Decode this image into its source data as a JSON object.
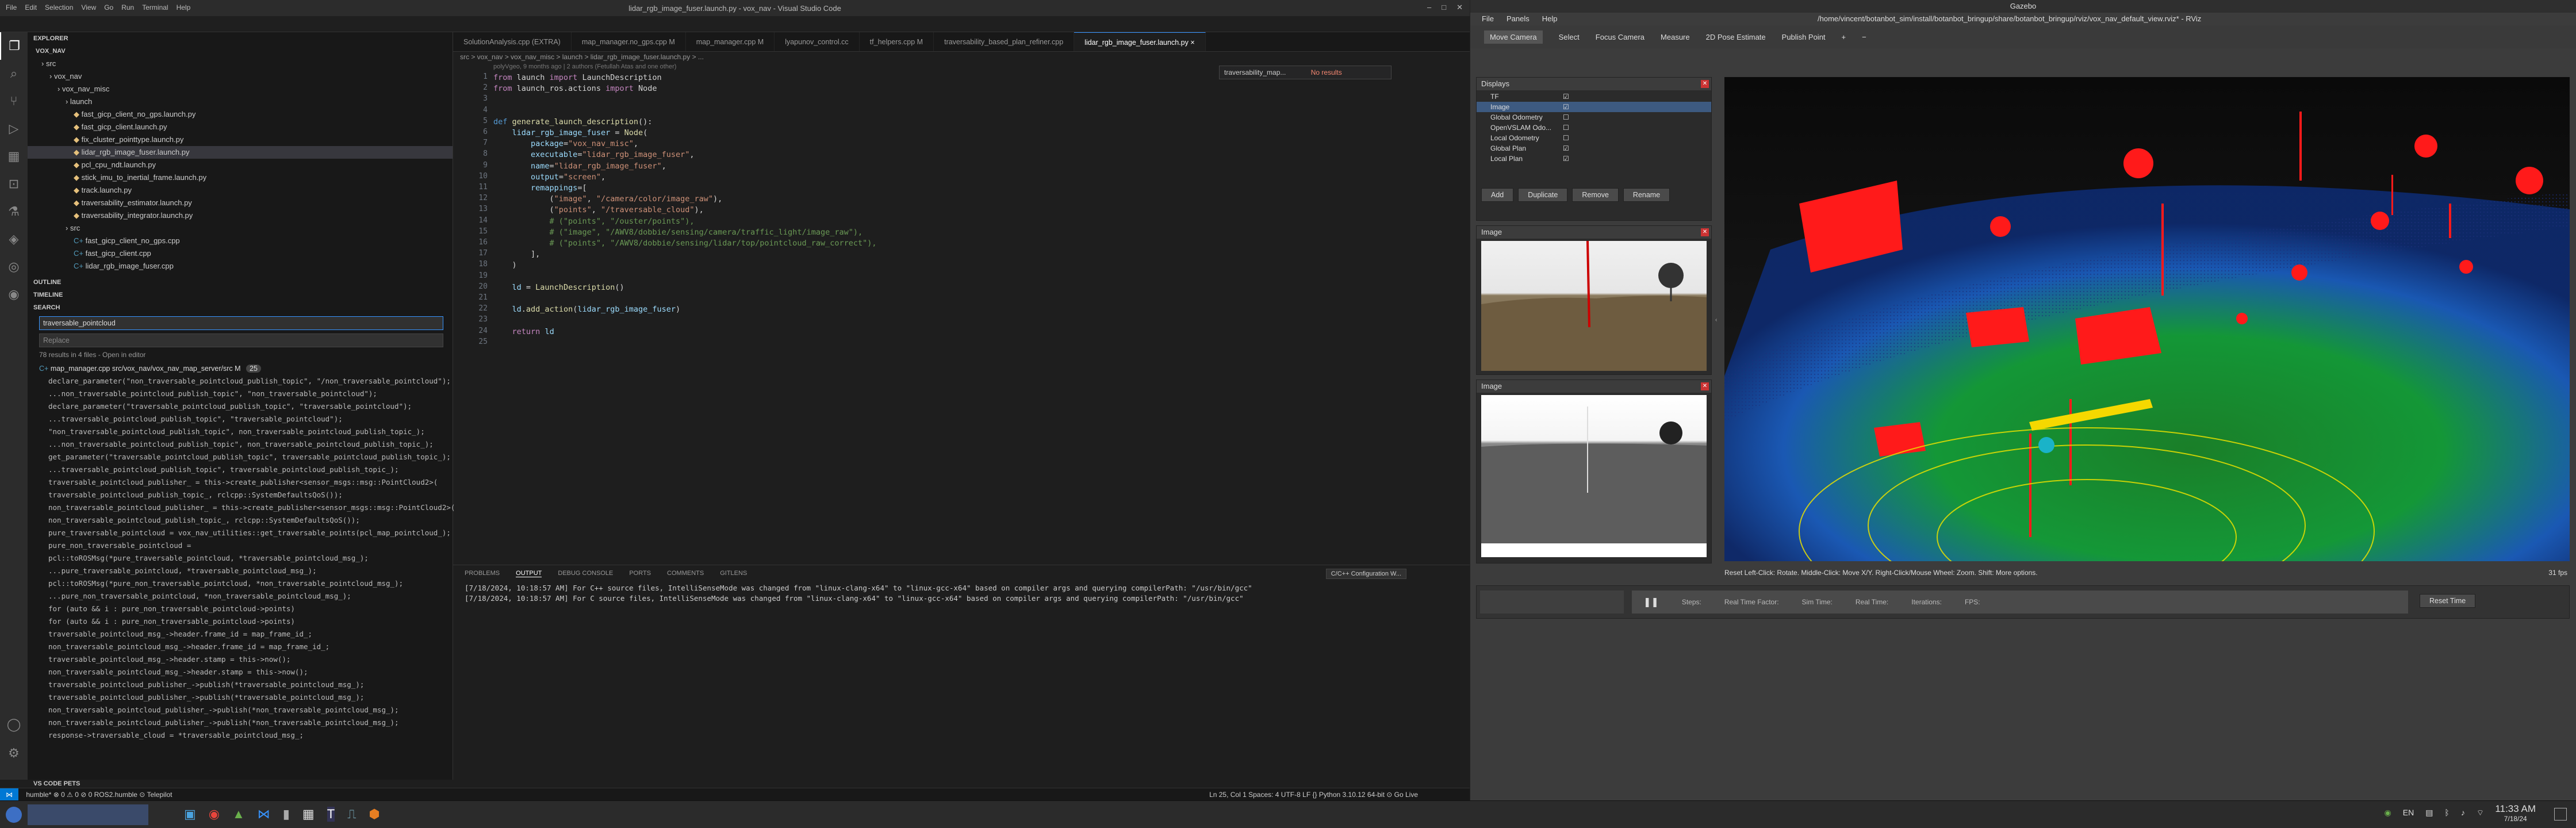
{
  "vscode": {
    "title": "lidar_rgb_image_fuser.launch.py - vox_nav - Visual Studio Code",
    "menu": [
      "File",
      "Edit",
      "Selection",
      "View",
      "Go",
      "Run",
      "Terminal",
      "Help"
    ],
    "explorer_title": "EXPLORER",
    "root": "VOX_NAV",
    "tree": [
      {
        "label": "src",
        "indent": 1
      },
      {
        "label": "vox_nav",
        "indent": 2
      },
      {
        "label": "vox_nav_misc",
        "indent": 3
      },
      {
        "label": "launch",
        "indent": 4
      },
      {
        "label": "fast_gicp_client_no_gps.launch.py",
        "indent": 5
      },
      {
        "label": "fast_gicp_client.launch.py",
        "indent": 5
      },
      {
        "label": "fix_cluster_pointtype.launch.py",
        "indent": 5
      },
      {
        "label": "lidar_rgb_image_fuser.launch.py",
        "indent": 5,
        "selected": true
      },
      {
        "label": "pcl_cpu_ndt.launch.py",
        "indent": 5
      },
      {
        "label": "stick_imu_to_inertial_frame.launch.py",
        "indent": 5
      },
      {
        "label": "track.launch.py",
        "indent": 5
      },
      {
        "label": "traversability_estimator.launch.py",
        "indent": 5
      },
      {
        "label": "traversability_integrator.launch.py",
        "indent": 5
      },
      {
        "label": "src",
        "indent": 4
      },
      {
        "label": "fast_gicp_client_no_gps.cpp",
        "indent": 5
      },
      {
        "label": "fast_gicp_client.cpp",
        "indent": 5
      },
      {
        "label": "lidar_rgb_image_fuser.cpp",
        "indent": 5
      }
    ],
    "outline": "OUTLINE",
    "timeline": "TIMELINE",
    "search": "SEARCH",
    "search_query": "traversable_pointcloud",
    "replace_placeholder": "Replace",
    "results_summary": "78 results in 4 files - Open in editor",
    "results_file": "map_manager.cpp  src/vox_nav/vox_nav_map_server/src  M",
    "results_count": "25",
    "results": [
      "declare_parameter(\"non_traversable_pointcloud_publish_topic\", \"/non_traversable_pointcloud\");",
      "...non_traversable_pointcloud_publish_topic\", \"non_traversable_pointcloud\");",
      "declare_parameter(\"traversable_pointcloud_publish_topic\", \"traversable_pointcloud\");",
      "...traversable_pointcloud_publish_topic\", \"traversable_pointcloud\");",
      "\"non_traversable_pointcloud_publish_topic\", non_traversable_pointcloud_publish_topic_);",
      "...non_traversable_pointcloud_publish_topic\", non_traversable_pointcloud_publish_topic_);",
      "get_parameter(\"traversable_pointcloud_publish_topic\", traversable_pointcloud_publish_topic_);",
      "...traversable_pointcloud_publish_topic\", traversable_pointcloud_publish_topic_);",
      "traversable_pointcloud_publisher_ = this->create_publisher<sensor_msgs::msg::PointCloud2>(",
      "traversable_pointcloud_publish_topic_, rclcpp::SystemDefaultsQoS());",
      "non_traversable_pointcloud_publisher_ = this->create_publisher<sensor_msgs::msg::PointCloud2>(",
      "non_traversable_pointcloud_publish_topic_, rclcpp::SystemDefaultsQoS());",
      "pure_traversable_pointcloud = vox_nav_utilities::get_traversable_points(pcl_map_pointcloud_);",
      "pure_non_traversable_pointcloud =",
      "pcl::toROSMsg(*pure_traversable_pointcloud, *traversable_pointcloud_msg_);",
      "...pure_traversable_pointcloud, *traversable_pointcloud_msg_);",
      "pcl::toROSMsg(*pure_non_traversable_pointcloud, *non_traversable_pointcloud_msg_);",
      "...pure_non_traversable_pointcloud, *non_traversable_pointcloud_msg_);",
      "for (auto && i : pure_non_traversable_pointcloud->points)",
      "for (auto && i : pure_non_traversable_pointcloud->points)",
      "traversable_pointcloud_msg_->header.frame_id = map_frame_id_;",
      "non_traversable_pointcloud_msg_->header.frame_id = map_frame_id_;",
      "traversable_pointcloud_msg_->header.stamp = this->now();",
      "non_traversable_pointcloud_msg_->header.stamp = this->now();",
      "traversable_pointcloud_publisher_->publish(*traversable_pointcloud_msg_);",
      "traversable_pointcloud_publisher_->publish(*traversable_pointcloud_msg_);",
      "non_traversable_pointcloud_publisher_->publish(*non_traversable_pointcloud_msg_);",
      "non_traversable_pointcloud_publisher_->publish(*non_traversable_pointcloud_msg_);",
      "response->traversable_cloud = *traversable_pointcloud_msg_;"
    ],
    "vs_code_prefs": "VS CODE PETS",
    "tabs": [
      {
        "label": "SolutionAnalysis.cpp  (EXTRA)"
      },
      {
        "label": "map_manager.no_gps.cpp  M"
      },
      {
        "label": "map_manager.cpp  M"
      },
      {
        "label": "lyapunov_control.cc"
      },
      {
        "label": "tf_helpers.cpp  M"
      },
      {
        "label": "traversability_based_plan_refiner.cpp"
      },
      {
        "label": "lidar_rgb_image_fuser.launch.py  ×",
        "active": true
      }
    ],
    "breadcrumb": "src > vox_nav > vox_nav_misc > launch > lidar_rgb_image_fuser.launch.py > ...",
    "blame": "polyVgeo, 9 months ago | 2 authors (Fetullah Atas and one other)",
    "find_query": "traversability_map...",
    "find_result": "No results",
    "line_numbers": [
      "1",
      "2",
      "3",
      "4",
      "5",
      "6",
      "7",
      "8",
      "9",
      "10",
      "11",
      "12",
      "13",
      "14",
      "15",
      "16",
      "17",
      "18",
      "19",
      "20",
      "21",
      "22",
      "23",
      "24",
      "25"
    ],
    "panel_tabs": [
      "PROBLEMS",
      "OUTPUT",
      "DEBUG CONSOLE",
      "PORTS",
      "COMMENTS",
      "GITLENS"
    ],
    "panel_channel": "C/C++ Configuration W...",
    "output": [
      "[7/18/2024, 10:18:57 AM] For C++ source files, IntelliSenseMode was changed from \"linux-clang-x64\" to \"linux-gcc-x64\" based on compiler args and querying compilerPath: \"/usr/bin/gcc\"",
      "[7/18/2024, 10:18:57 AM] For C source files, IntelliSenseMode was changed from \"linux-clang-x64\" to \"linux-gcc-x64\" based on compiler args and querying compilerPath: \"/usr/bin/gcc\""
    ],
    "status_left": "humble*  ⊗ 0 ⚠ 0   ⊘ 0   ROS2.humble   ⊙ Telepilot",
    "status_right": "Ln 25, Col 1    Spaces: 4    UTF-8    LF    {} Python    3.10.12 64-bit    ⊙ Go Live"
  },
  "rviz": {
    "window_title": "Gazebo",
    "path": "/home/vincent/botanbot_sim/install/botanbot_bringup/share/botanbot_bringup/rviz/vox_nav_default_view.rviz* - RViz",
    "menu": [
      "File",
      "Panels",
      "Help"
    ],
    "tools": [
      "Move Camera",
      "Select",
      "Focus Camera",
      "Measure",
      "2D Pose Estimate",
      "Publish Point",
      "+",
      "−"
    ],
    "displays_title": "Displays",
    "displays": [
      {
        "label": "TF",
        "checked": true
      },
      {
        "label": "Image",
        "checked": true
      },
      {
        "label": "Global Odometry",
        "checked": false
      },
      {
        "label": "OpenVSLAM Odo...",
        "checked": false
      },
      {
        "label": "Local Odometry",
        "checked": false
      },
      {
        "label": "Global Plan",
        "checked": true
      },
      {
        "label": "Local Plan",
        "checked": true
      }
    ],
    "buttons": [
      "Add",
      "Duplicate",
      "Remove",
      "Rename"
    ],
    "image1_title": "Image",
    "image2_title": "Image",
    "status_hint": "Reset  Left-Click: Rotate.  Middle-Click: Move X/Y.  Right-Click/Mouse Wheel: Zoom.  Shift: More options.",
    "fps": "31 fps",
    "time_labels": [
      "Steps:",
      "Real Time Factor:",
      "Sim Time:",
      "Real Time:",
      "Iterations:",
      "FPS:"
    ],
    "reset_time": "Reset Time"
  },
  "taskbar": {
    "clock": "11:33 AM",
    "date": "7/18/24",
    "lang": "EN"
  },
  "colors": {
    "accent": "#3794ff",
    "highlight": "#8a4a1a"
  }
}
